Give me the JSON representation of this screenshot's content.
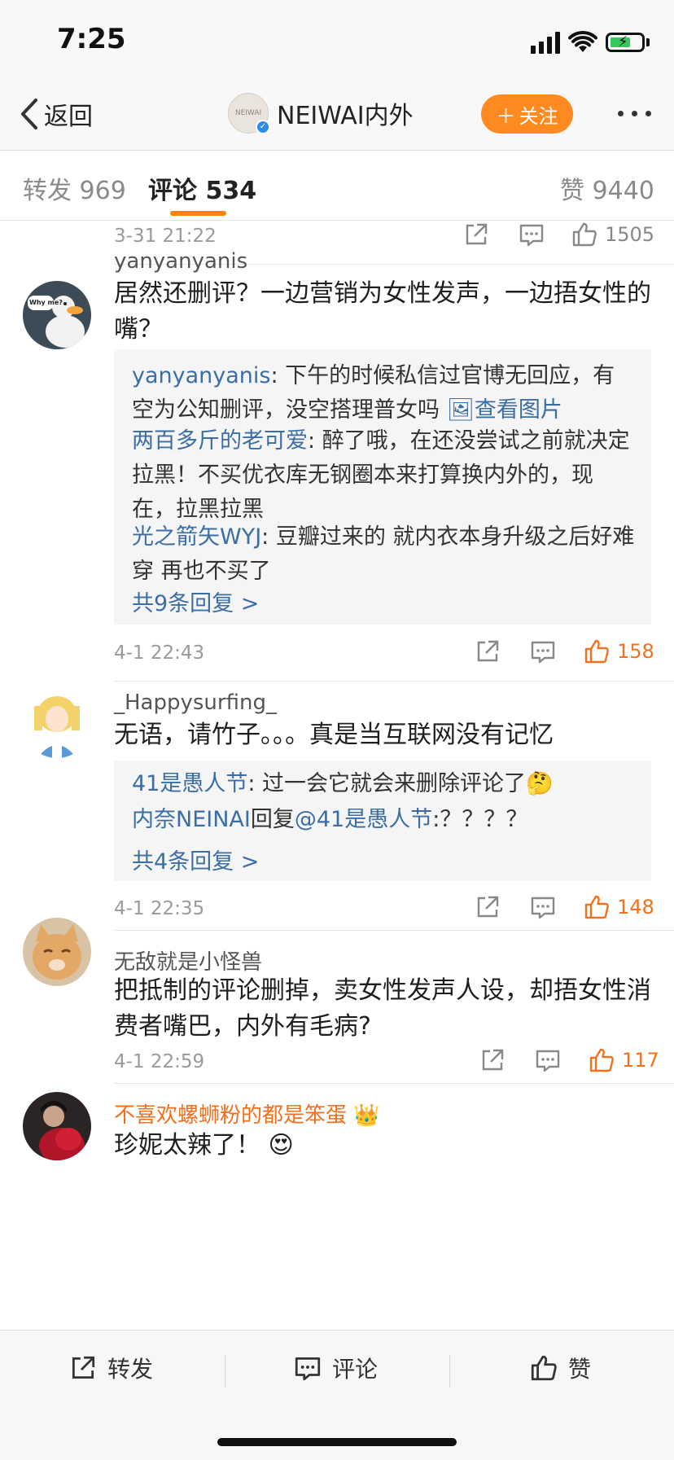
{
  "status": {
    "time": "7:25"
  },
  "nav": {
    "back_label": "返回",
    "title": "NEIWAI内外",
    "avatar_text": "NEIWAI",
    "follow_label": "关注"
  },
  "tabs": [
    {
      "label": "转发",
      "count": "969"
    },
    {
      "label": "评论",
      "count": "534"
    },
    {
      "label": "赞",
      "count": "9440"
    }
  ],
  "top_meta": {
    "time": "3-31 21:22",
    "likes": "1505"
  },
  "comments": [
    {
      "username": "yanyanyanis",
      "avatar_text": "Why me?",
      "text": "居然还删评？一边营销为女性发声，一边捂女性的嘴？",
      "replies": [
        {
          "user": "yanyanyanis",
          "text": "下午的时候私信过官博无回应，有空为公知删评，没空搭理普女吗",
          "link": "查看图片"
        },
        {
          "user": "两百多斤的老可爱",
          "text": "醉了哦，在还没尝试之前就决定拉黑！不买优衣库无钢圈本来打算换内外的，现在，拉黑拉黑"
        },
        {
          "user": "光之箭矢WYJ",
          "text": "豆瓣过来的 就内衣本身升级之后好难穿 再也不买了"
        }
      ],
      "more_replies": "共9条回复 >",
      "time": "4-1 22:43",
      "likes": "158"
    },
    {
      "username": "_Happysurfing_",
      "text": "无语，请竹子。。。真是当互联网没有记忆",
      "replies": [
        {
          "user": "41是愚人节",
          "text": "过一会它就会来删除评论了",
          "emoji": "🤔"
        },
        {
          "user": "内奈NEINAI",
          "mid": "回复",
          "mention": "@41是愚人节",
          "text": ":？？？？"
        }
      ],
      "more_replies": "共4条回复 >",
      "time": "4-1 22:35",
      "likes": "148"
    },
    {
      "username": "无敌就是小怪兽",
      "text": "把抵制的评论删掉，卖女性发声人设，却捂女性消费者嘴巴，内外有毛病?",
      "time": "4-1 22:59",
      "likes": "117"
    },
    {
      "username": "不喜欢螺蛳粉的都是笨蛋",
      "badge": "👑",
      "text": "珍妮太辣了！",
      "emoji": "😍"
    }
  ],
  "bottom_bar": {
    "repost": "转发",
    "comment": "评论",
    "like": "赞"
  },
  "colors": {
    "accent": "#ff8200",
    "like_active": "#f2711c",
    "link": "#3b6ea5"
  }
}
